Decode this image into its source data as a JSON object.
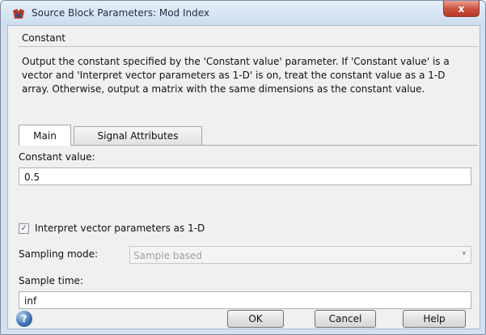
{
  "window": {
    "title": "Source Block Parameters: Mod Index",
    "close_glyph": "x",
    "accent_color": "#c8513c"
  },
  "block": {
    "name": "Constant",
    "description": "Output the constant specified by the 'Constant value' parameter. If 'Constant value' is a vector and 'Interpret vector parameters as 1-D' is on, treat the constant value as a 1-D array. Otherwise, output a matrix with the same dimensions as the constant value."
  },
  "tabs": [
    {
      "label": "Main",
      "active": true
    },
    {
      "label": "Signal Attributes",
      "active": false
    }
  ],
  "params": {
    "constant_value_label": "Constant value:",
    "constant_value": "0.5",
    "interpret_label": "Interpret vector parameters as 1-D",
    "interpret_checked": true,
    "check_glyph": "✓",
    "sampling_mode_label": "Sampling mode:",
    "sampling_mode_value": "Sample based",
    "dropdown_glyph": "▾",
    "sample_time_label": "Sample time:",
    "sample_time_value": "inf"
  },
  "footer": {
    "help_icon": "help-icon",
    "help_glyph": "?",
    "ok_label": "OK",
    "cancel_label": "Cancel",
    "help_label": "Help"
  }
}
